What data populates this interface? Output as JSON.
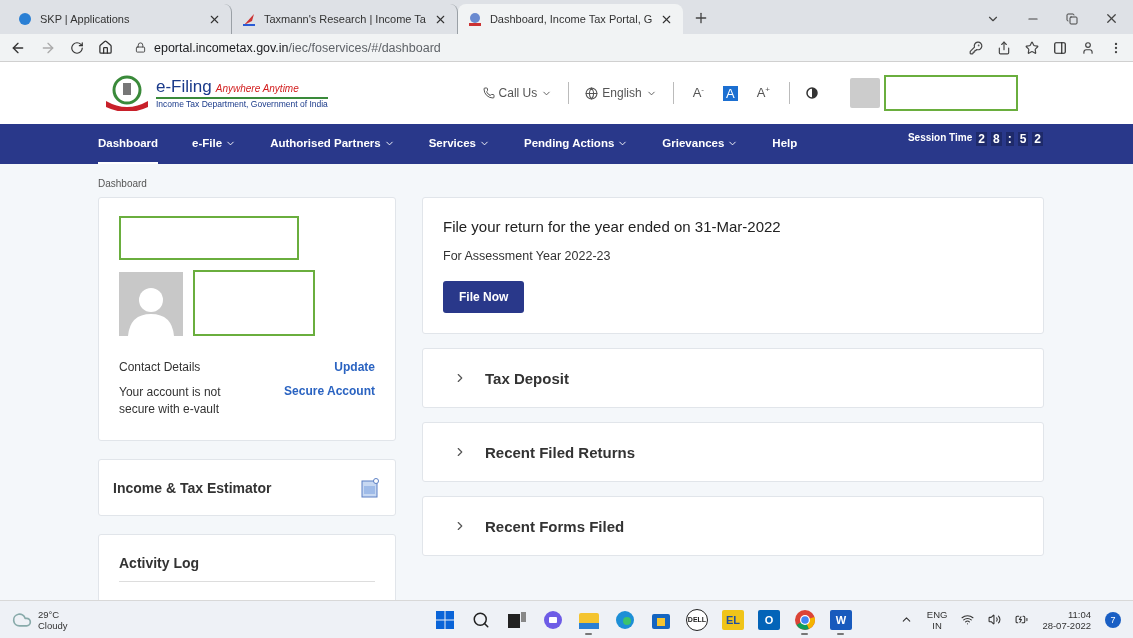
{
  "browser": {
    "tabs": [
      {
        "title": "SKP | Applications",
        "selected": false
      },
      {
        "title": "Taxmann's Research | Income Ta",
        "selected": false
      },
      {
        "title": "Dashboard, Income Tax Portal, G",
        "selected": true
      }
    ],
    "url_host": "eportal.incometax.gov.in",
    "url_path": "/iec/foservices/#/dashboard"
  },
  "header": {
    "brand": "e-Filing",
    "tagline": "Anywhere Anytime",
    "department": "Income Tax Department, Government of India",
    "call_us": "Call Us",
    "language": "English",
    "font_small": "A",
    "font_small_sign": "-",
    "font_normal": "A",
    "font_large": "A",
    "font_large_sign": "+"
  },
  "nav": {
    "items": [
      {
        "label": "Dashboard",
        "has_menu": false,
        "selected": true
      },
      {
        "label": "e-File",
        "has_menu": true,
        "selected": false
      },
      {
        "label": "Authorised Partners",
        "has_menu": true,
        "selected": false
      },
      {
        "label": "Services",
        "has_menu": true,
        "selected": false
      },
      {
        "label": "Pending Actions",
        "has_menu": true,
        "selected": false
      },
      {
        "label": "Grievances",
        "has_menu": true,
        "selected": false
      },
      {
        "label": "Help",
        "has_menu": false,
        "selected": false
      }
    ],
    "session_label": "Session Time",
    "session_digits": [
      "2",
      "8",
      ":",
      "5",
      "2"
    ]
  },
  "breadcrumb": "Dashboard",
  "profile": {
    "contact_label": "Contact Details",
    "contact_action": "Update",
    "security_text": "Your account is not secure with e-vault",
    "security_action": "Secure Account"
  },
  "estimator": {
    "title": "Income & Tax Estimator"
  },
  "activity_log": {
    "title": "Activity Log"
  },
  "file_return": {
    "title": "File your return for the year ended on 31-Mar-2022",
    "subtitle": "For Assessment Year 2022-23",
    "button": "File Now"
  },
  "sections": [
    {
      "title": "Tax Deposit",
      "expanded": false
    },
    {
      "title": "Recent Filed Returns",
      "expanded": false
    },
    {
      "title": "Recent Forms Filed",
      "expanded": false
    }
  ],
  "taskbar": {
    "temperature": "29°C",
    "weather": "Cloudy",
    "apps": [
      {
        "kind": "start",
        "running": false
      },
      {
        "kind": "search",
        "running": false
      },
      {
        "kind": "taskview",
        "running": false
      },
      {
        "kind": "chat",
        "running": false
      },
      {
        "kind": "explorer",
        "running": true
      },
      {
        "kind": "edge",
        "running": false
      },
      {
        "kind": "store",
        "running": false
      },
      {
        "kind": "dell",
        "label": "DELL",
        "running": false
      },
      {
        "kind": "tile",
        "label": "EL",
        "running": false
      },
      {
        "kind": "outlook",
        "label": "O",
        "running": false
      },
      {
        "kind": "chrome",
        "running": true
      },
      {
        "kind": "word",
        "label": "W",
        "running": true
      }
    ],
    "lang": "ENG",
    "region": "IN",
    "time": "11:04",
    "date": "28-07-2022",
    "notifications": "7"
  }
}
